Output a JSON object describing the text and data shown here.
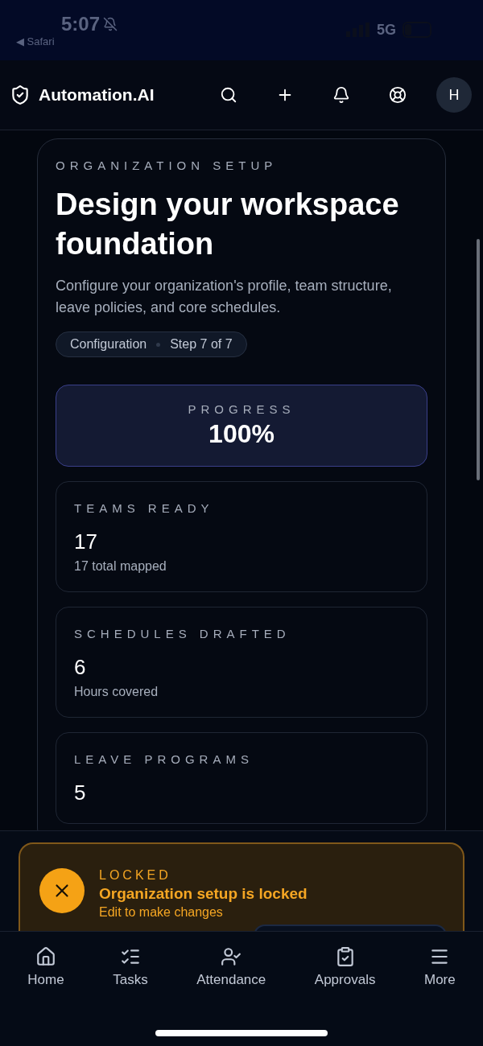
{
  "status_bar": {
    "time": "5:07",
    "back_app": "◀ Safari",
    "network": "5G"
  },
  "header": {
    "brand": "Automation.AI",
    "avatar": "H"
  },
  "setup": {
    "eyebrow": "ORGANIZATION SETUP",
    "title": "Design your workspace foundation",
    "description": "Configure your organization's profile, team structure, leave policies, and core schedules.",
    "chips": [
      "Configuration",
      "Step 7 of 7"
    ],
    "progress": {
      "label": "PROGRESS",
      "value": "100%"
    },
    "stats": [
      {
        "label": "TEAMS READY",
        "value": "17",
        "note": "17 total mapped"
      },
      {
        "label": "SCHEDULES DRAFTED",
        "value": "6",
        "note": "Hours covered"
      },
      {
        "label": "LEAVE PROGRAMS",
        "value": "5"
      }
    ]
  },
  "banner": {
    "eyebrow": "LOCKED",
    "title": "Organization setup is locked",
    "subtitle": "Edit to make changes"
  },
  "bottom_nav": [
    {
      "kind": "home",
      "label": "Home"
    },
    {
      "kind": "tasks",
      "label": "Tasks"
    },
    {
      "kind": "attendance",
      "label": "Attendance"
    },
    {
      "kind": "approvals",
      "label": "Approvals"
    },
    {
      "kind": "more",
      "label": "More"
    }
  ]
}
